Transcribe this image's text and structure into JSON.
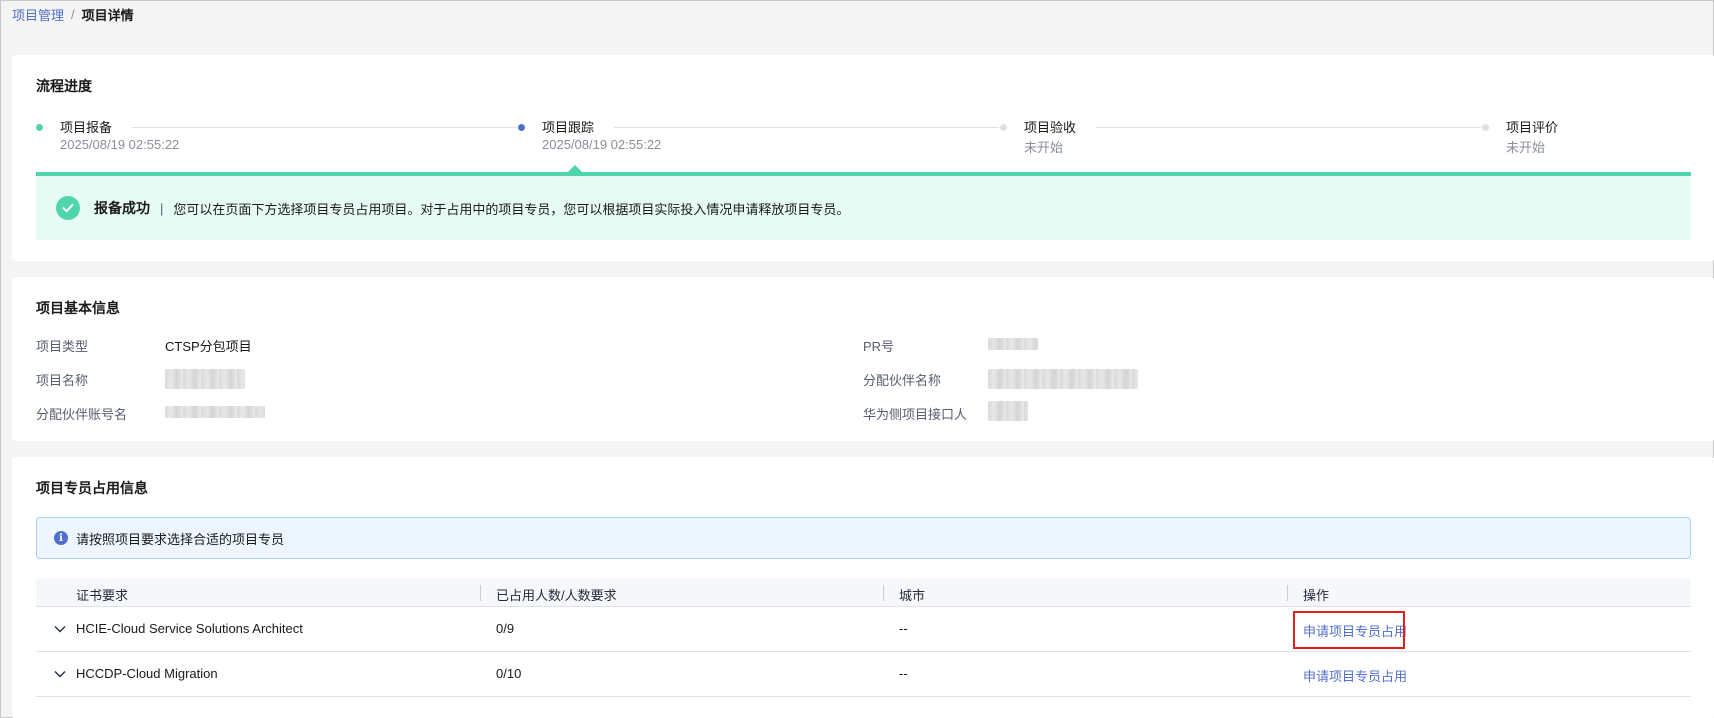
{
  "breadcrumb": {
    "parent": "项目管理",
    "separator": "/",
    "current": "项目详情"
  },
  "progress": {
    "title": "流程进度",
    "steps": [
      {
        "label": "项目报备",
        "time": "2025/08/19 02:55:22",
        "status": "done"
      },
      {
        "label": "项目跟踪",
        "time": "2025/08/19 02:55:22",
        "status": "current"
      },
      {
        "label": "项目验收",
        "time": "未开始",
        "status": "pending"
      },
      {
        "label": "项目评价",
        "time": "未开始",
        "status": "pending"
      }
    ],
    "success_title": "报备成功",
    "success_separator": "|",
    "success_message": "您可以在页面下方选择项目专员占用项目。对于占用中的项目专员，您可以根据项目实际投入情况申请释放项目专员。"
  },
  "basic_info": {
    "title": "项目基本信息",
    "fields": {
      "project_type_label": "项目类型",
      "project_type_value": "CTSP分包项目",
      "project_name_label": "项目名称",
      "partner_account_label": "分配伙伴账号名",
      "pr_label": "PR号",
      "partner_name_label": "分配伙伴名称",
      "huawei_contact_label": "华为侧项目接口人"
    }
  },
  "specialist": {
    "title": "项目专员占用信息",
    "notice": "请按照项目要求选择合适的项目专员",
    "columns": [
      "证书要求",
      "已占用人数/人数要求",
      "城市",
      "操作"
    ],
    "rows": [
      {
        "cert": "HCIE-Cloud Service Solutions Architect",
        "count": "0/9",
        "city": "--",
        "action": "申请项目专员占用"
      },
      {
        "cert": "HCCDP-Cloud Migration",
        "count": "0/10",
        "city": "--",
        "action": "申请项目专员占用"
      }
    ]
  },
  "colors": {
    "accent": "#526ecc",
    "success": "#50d4ab",
    "highlight": "#e02020"
  }
}
